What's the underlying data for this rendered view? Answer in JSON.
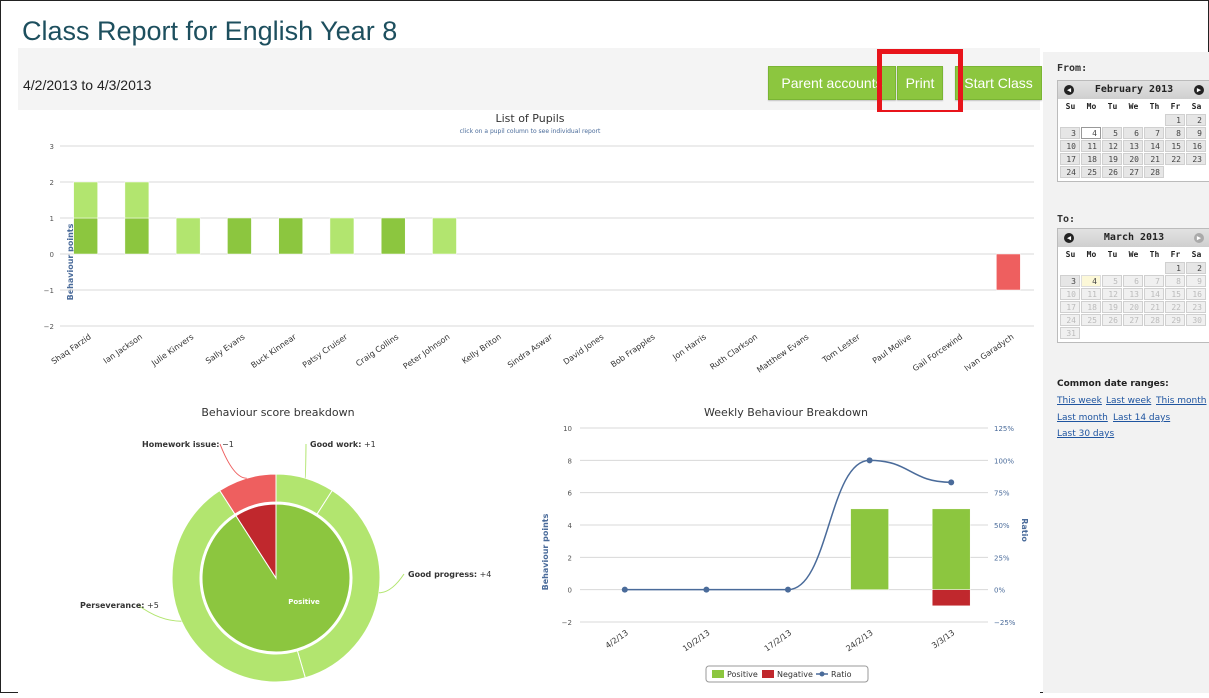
{
  "page": {
    "title": "Class Report for English Year 8",
    "date_range": "4/2/2013 to 4/3/2013"
  },
  "toolbar": {
    "parent_accounts_label": "Parent accounts",
    "print_label": "Print",
    "start_class_label": "Start Class"
  },
  "colors": {
    "positive": "#8cc63f",
    "positive_light": "#b2e56f",
    "negative": "#c0282d",
    "negative_light": "#ee5f5f",
    "ratio_line": "#4a6b9a",
    "title_text": "#1d4f5e",
    "highlight": "#e8141b"
  },
  "sidebar": {
    "from_label": "From:",
    "to_label": "To:",
    "from_calendar": {
      "month": "February 2013",
      "weekdays": [
        "Su",
        "Mo",
        "Tu",
        "We",
        "Th",
        "Fr",
        "Sa"
      ],
      "weeks": [
        [
          "",
          "",
          "",
          "",
          "",
          "1",
          "2"
        ],
        [
          "3",
          "4",
          "5",
          "6",
          "7",
          "8",
          "9"
        ],
        [
          "10",
          "11",
          "12",
          "13",
          "14",
          "15",
          "16"
        ],
        [
          "17",
          "18",
          "19",
          "20",
          "21",
          "22",
          "23"
        ],
        [
          "24",
          "25",
          "26",
          "27",
          "28",
          "",
          ""
        ]
      ],
      "selected_day": "4"
    },
    "to_calendar": {
      "month": "March 2013",
      "weekdays": [
        "Su",
        "Mo",
        "Tu",
        "We",
        "Th",
        "Fr",
        "Sa"
      ],
      "weeks": [
        [
          "",
          "",
          "",
          "",
          "",
          "1",
          "2"
        ],
        [
          "3",
          "4",
          "5",
          "6",
          "7",
          "8",
          "9"
        ],
        [
          "10",
          "11",
          "12",
          "13",
          "14",
          "15",
          "16"
        ],
        [
          "17",
          "18",
          "19",
          "20",
          "21",
          "22",
          "23"
        ],
        [
          "24",
          "25",
          "26",
          "27",
          "28",
          "29",
          "30"
        ],
        [
          "31",
          "",
          "",
          "",
          "",
          "",
          ""
        ]
      ],
      "selected_day": "4"
    },
    "common_ranges_title": "Common date ranges:",
    "ranges": [
      "This week",
      "Last week",
      "This month",
      "Last month",
      "Last 14 days",
      "Last 30 days"
    ]
  },
  "chart_data": [
    {
      "type": "bar",
      "title": "List of Pupils",
      "subtitle": "click on a pupil column to see individual report",
      "ylabel": "Behaviour points",
      "ylim": [
        -2,
        3
      ],
      "yticks": [
        3,
        2,
        1,
        0,
        -1,
        -2
      ],
      "categories": [
        "Shaq Farzid",
        "Ian Jackson",
        "Julie Kinvers",
        "Sally Evans",
        "Buck Kinnear",
        "Patsy Cruiser",
        "Craig Collins",
        "Peter Johnson",
        "Kelly Briton",
        "Sindra Aswar",
        "David Jones",
        "Bob Frapples",
        "Jon Harris",
        "Ruth Clarkson",
        "Matthew Evans",
        "Tom Lester",
        "Paul Molive",
        "Gail Forcewind",
        "Ivan Garadych"
      ],
      "values": [
        2,
        2,
        1,
        1,
        1,
        1,
        1,
        1,
        0,
        0,
        0,
        0,
        0,
        0,
        0,
        0,
        0,
        0,
        -1
      ]
    },
    {
      "type": "pie",
      "title": "Behaviour score breakdown",
      "inner": [
        {
          "name": "Positive",
          "value": 10
        },
        {
          "name": "Negative",
          "value": 1
        }
      ],
      "outer": [
        {
          "name": "Good work",
          "value": 1,
          "label": "+1"
        },
        {
          "name": "Good progress",
          "value": 4,
          "label": "+4"
        },
        {
          "name": "Perseverance",
          "value": 5,
          "label": "+5"
        },
        {
          "name": "Homework issue",
          "value": 1,
          "label": "−1"
        }
      ]
    },
    {
      "type": "bar",
      "title": "Weekly Behaviour Breakdown",
      "ylabel": "Behaviour points",
      "y2label": "Ratio",
      "categories": [
        "4/2/13",
        "10/2/13",
        "17/2/13",
        "24/2/13",
        "3/3/13"
      ],
      "ylim": [
        -2,
        10
      ],
      "yticks": [
        10,
        8,
        6,
        4,
        2,
        0,
        -2
      ],
      "y2lim": [
        -25,
        125
      ],
      "y2ticks": [
        "125%",
        "100%",
        "75%",
        "50%",
        "25%",
        "0%",
        "−25%"
      ],
      "series": [
        {
          "name": "Positive",
          "type": "bar",
          "values": [
            0,
            0,
            0,
            5,
            5
          ]
        },
        {
          "name": "Negative",
          "type": "bar",
          "values": [
            0,
            0,
            0,
            0,
            -1
          ]
        },
        {
          "name": "Ratio",
          "type": "line",
          "axis": "y2",
          "values": [
            0,
            0,
            0,
            100,
            83
          ]
        }
      ],
      "legend": "bottom"
    }
  ]
}
